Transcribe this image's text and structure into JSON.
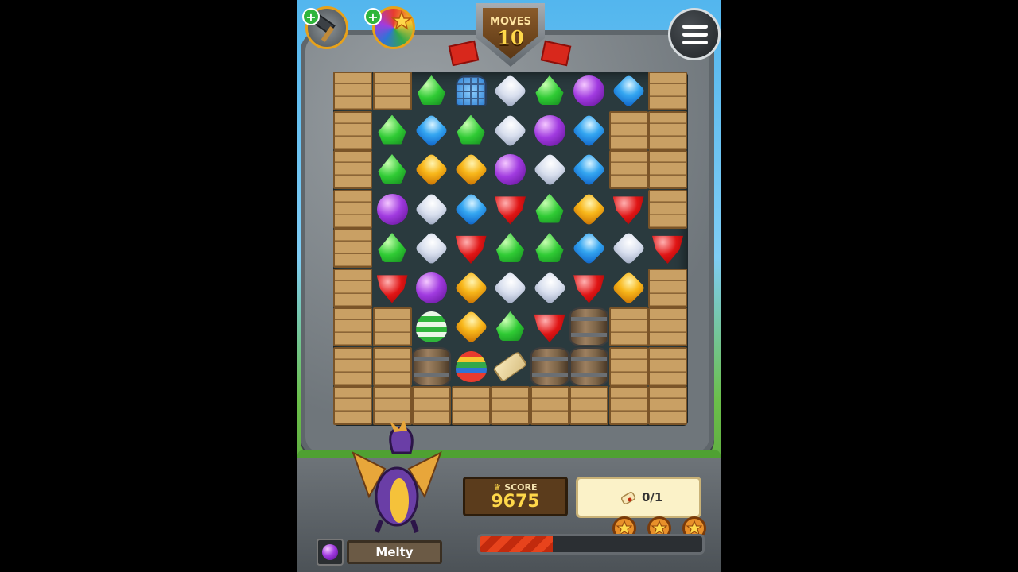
{
  "hud": {
    "moves_label": "MOVES",
    "moves_value": "10",
    "menu_icon": "menu-icon",
    "boosters": [
      {
        "name": "hammer-booster",
        "icon": "hammer-icon"
      },
      {
        "name": "rainbow-booster",
        "icon": "rainbow-ball-icon"
      }
    ]
  },
  "board": {
    "rows": 9,
    "cols": 9,
    "grid": [
      [
        "crate",
        "crate",
        "green",
        "cage",
        "white",
        "green",
        "purple",
        "blue",
        "crate"
      ],
      [
        "crate",
        "green",
        "blue",
        "green",
        "white",
        "purple",
        "blue",
        "crate",
        "crate"
      ],
      [
        "crate",
        "green",
        "yellow",
        "yellow",
        "purple",
        "white",
        "blue",
        "crate",
        "crate"
      ],
      [
        "crate",
        "purple",
        "white",
        "blue",
        "red",
        "green",
        "yellow",
        "red",
        "crate"
      ],
      [
        "crate",
        "green",
        "white",
        "red",
        "green",
        "green",
        "blue",
        "white",
        "red"
      ],
      [
        "crate",
        "red",
        "purple",
        "yellow",
        "white",
        "white",
        "red",
        "yellow",
        "crate"
      ],
      [
        "crate",
        "crate",
        "egg-green",
        "yellow",
        "green",
        "red",
        "barrel",
        "crate",
        "crate"
      ],
      [
        "crate",
        "crate",
        "barrel",
        "egg-rainbow",
        "scroll",
        "barrel",
        "barrel",
        "crate",
        "crate"
      ],
      [
        "crate",
        "crate",
        "crate",
        "crate",
        "crate",
        "crate",
        "crate",
        "crate",
        "crate"
      ]
    ]
  },
  "score": {
    "label": "SCORE",
    "value": "9675"
  },
  "goal": {
    "icon": "scroll-icon",
    "value": "0/1"
  },
  "stars": 3,
  "progress_fraction": 0.33,
  "character": {
    "name": "Melty"
  },
  "colors": {
    "green": "#2fcb34",
    "blue": "#34a6f1",
    "purple": "#a13be0",
    "white": "#d8dfee",
    "yellow": "#f8b71a",
    "red": "#e01515"
  }
}
